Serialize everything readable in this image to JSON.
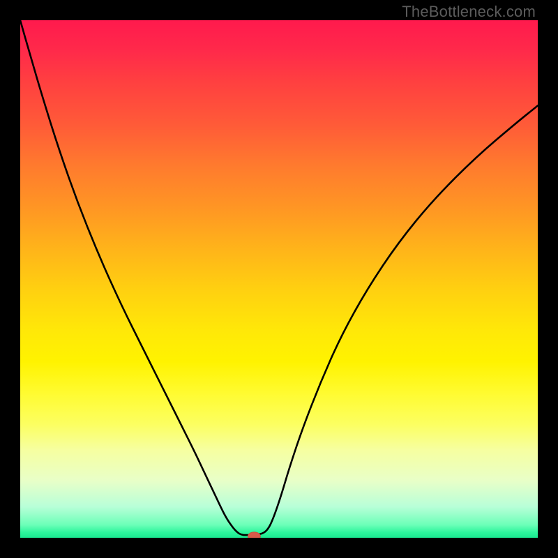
{
  "watermark": "TheBottleneck.com",
  "chart_data": {
    "type": "line",
    "title": "",
    "xlabel": "",
    "ylabel": "",
    "xlim": [
      0,
      1
    ],
    "ylim": [
      0,
      1
    ],
    "grid": false,
    "legend": false,
    "series": [
      {
        "name": "curve",
        "x": [
          0.0,
          0.02,
          0.045,
          0.075,
          0.11,
          0.15,
          0.195,
          0.24,
          0.28,
          0.31,
          0.335,
          0.355,
          0.372,
          0.388,
          0.4,
          0.412,
          0.42,
          0.427,
          0.435,
          0.465,
          0.478,
          0.488,
          0.502,
          0.52,
          0.545,
          0.58,
          0.62,
          0.67,
          0.73,
          0.8,
          0.88,
          0.96,
          1.0
        ],
        "y": [
          1.0,
          0.93,
          0.845,
          0.75,
          0.65,
          0.55,
          0.45,
          0.36,
          0.28,
          0.22,
          0.17,
          0.128,
          0.092,
          0.058,
          0.035,
          0.018,
          0.01,
          0.006,
          0.005,
          0.006,
          0.015,
          0.035,
          0.075,
          0.135,
          0.21,
          0.3,
          0.39,
          0.48,
          0.57,
          0.655,
          0.735,
          0.803,
          0.835
        ]
      }
    ],
    "annotations": [
      {
        "name": "marker-dot",
        "x": 0.452,
        "y": 0.003,
        "color": "#d85a4a",
        "rx": 9,
        "ry": 6
      }
    ],
    "background": {
      "type": "vertical-gradient",
      "stops": [
        {
          "pos": 0.0,
          "color": "#ff1a4d"
        },
        {
          "pos": 0.5,
          "color": "#ffd010"
        },
        {
          "pos": 0.8,
          "color": "#fcff60"
        },
        {
          "pos": 1.0,
          "color": "#1ae890"
        }
      ]
    }
  }
}
